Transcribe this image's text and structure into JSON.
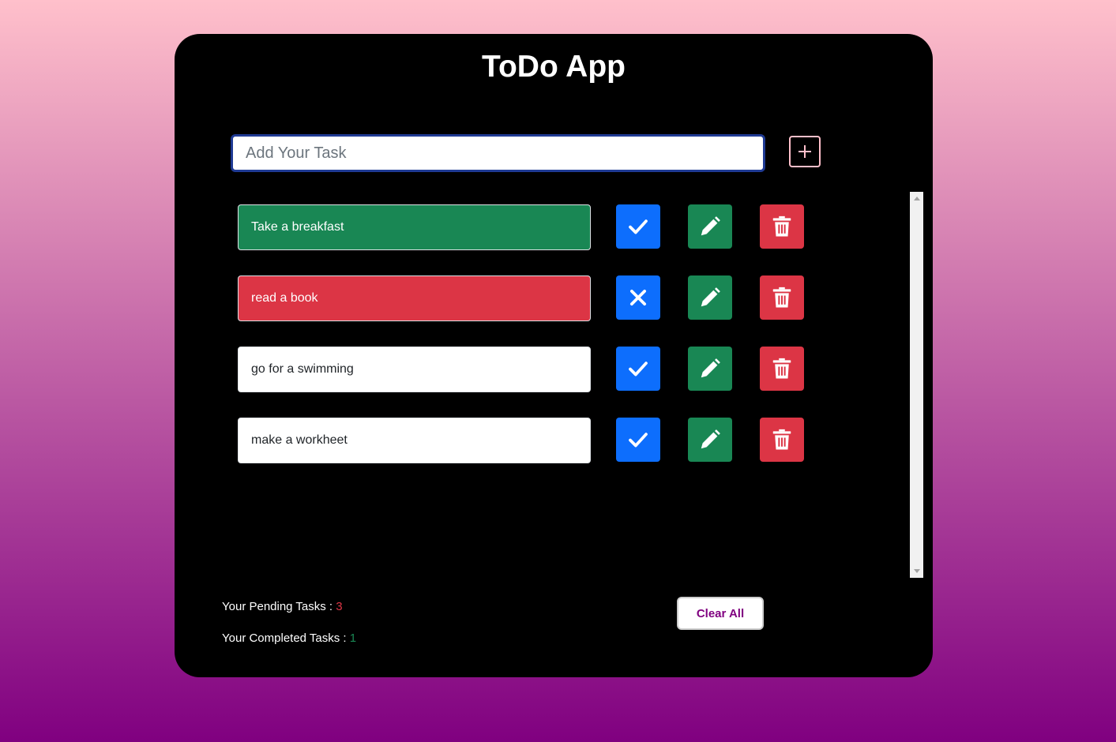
{
  "app": {
    "title": "ToDo App"
  },
  "input": {
    "placeholder": "Add Your Task",
    "value": ""
  },
  "add_button": {
    "icon": "plus-square-icon"
  },
  "tasks": [
    {
      "text": "Take a breakfast",
      "status": "completed",
      "toggle_icon": "check-icon"
    },
    {
      "text": "read a book",
      "status": "not-completed",
      "toggle_icon": "x-icon"
    },
    {
      "text": "go for a swimming",
      "status": "pending",
      "toggle_icon": "check-icon"
    },
    {
      "text": "make a workheet",
      "status": "pending",
      "toggle_icon": "check-icon"
    }
  ],
  "stats": {
    "pending_label": "Your Pending Tasks : ",
    "pending_count": "3",
    "completed_label": "Your Completed Tasks : ",
    "completed_count": "1"
  },
  "clear_button": {
    "label": "Clear All"
  },
  "colors": {
    "background_top": "#ffc0cb",
    "background_bottom": "#800080",
    "primary": "#0d6efd",
    "success": "#198754",
    "danger": "#dc3545",
    "clear_text": "#800080"
  }
}
